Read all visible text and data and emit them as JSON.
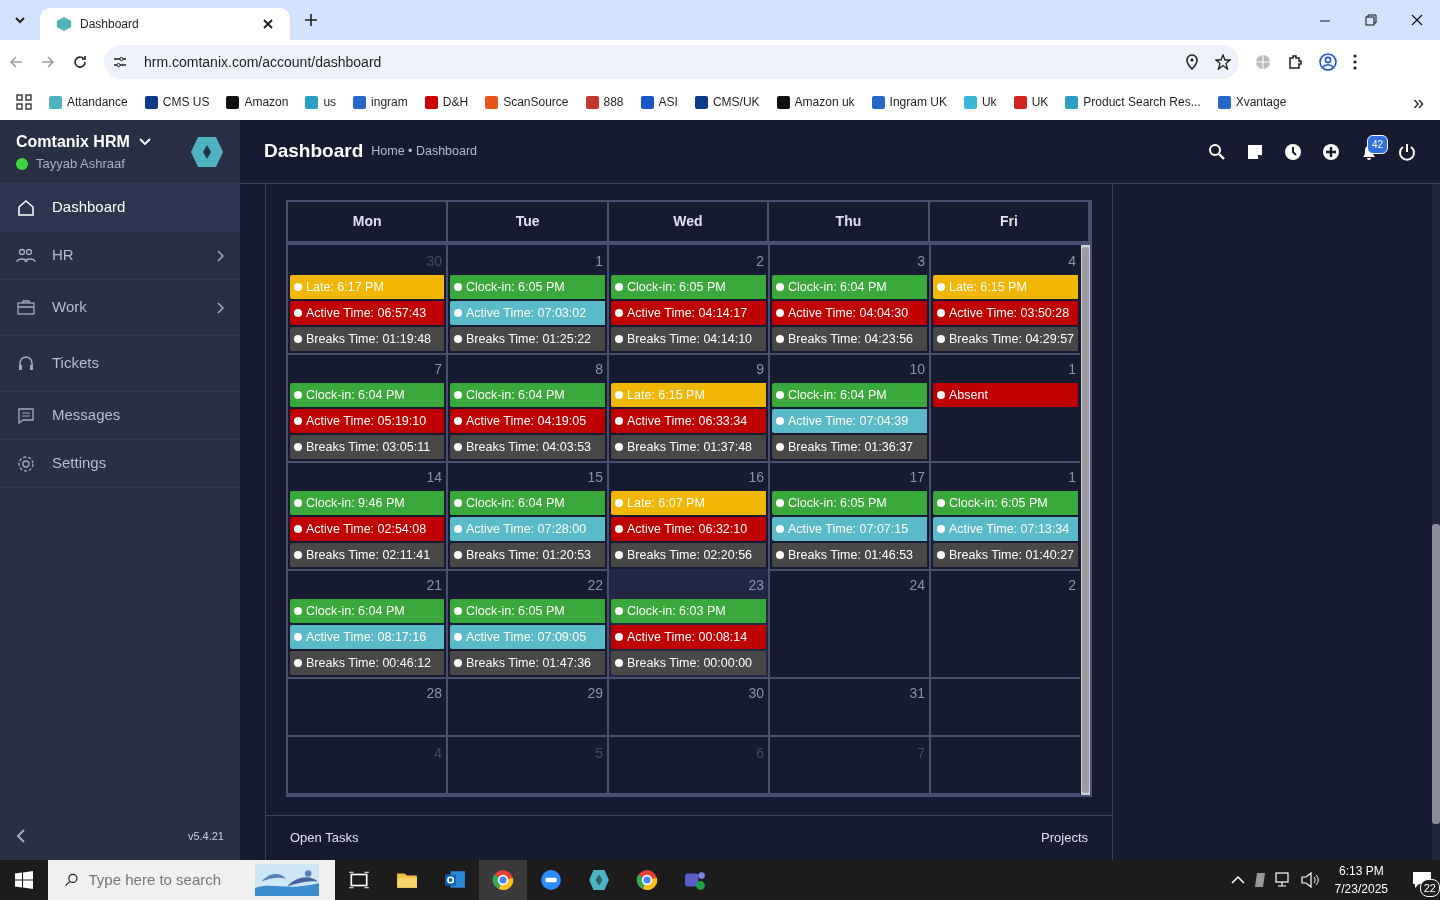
{
  "browser": {
    "tab": {
      "title": "Dashboard"
    },
    "url": "hrm.comtanix.com/account/dashboard",
    "bookmarks": [
      "Attandance",
      "CMS US",
      "Amazon",
      "us",
      "ingram",
      "D&H",
      "ScanSource",
      "888",
      "ASI",
      "CMS/UK",
      "Amazon uk",
      "Ingram UK",
      "Uk",
      "UK",
      "Product Search Res...",
      "Xvantage"
    ],
    "more": "»"
  },
  "sidebar": {
    "app_name": "Comtanix HRM",
    "user": "Tayyab Ashraaf",
    "online": true,
    "items": [
      {
        "label": "Dashboard",
        "selected": true,
        "has_children": false
      },
      {
        "label": "HR",
        "selected": false,
        "has_children": true
      },
      {
        "label": "Work",
        "selected": false,
        "has_children": true
      },
      {
        "label": "Tickets",
        "selected": false,
        "has_children": false
      },
      {
        "label": "Messages",
        "selected": false,
        "has_children": false
      },
      {
        "label": "Settings",
        "selected": false,
        "has_children": false
      }
    ],
    "version": "v5.4.21"
  },
  "header": {
    "title": "Dashboard",
    "breadcrumb": "Home • Dashboard",
    "notification_count": "42"
  },
  "calendar": {
    "days": [
      "Mon",
      "Tue",
      "Wed",
      "Thu",
      "Fri"
    ],
    "weeks": [
      [
        {
          "number": "30",
          "other_month": true,
          "today": false,
          "events": [
            {
              "text": "Late: 6:17 PM",
              "color": "#f2b705"
            },
            {
              "text": "Active Time: 06:57:43",
              "color": "#c00000"
            },
            {
              "text": "Breaks Time: 01:19:48",
              "color": "#484848"
            }
          ]
        },
        {
          "number": "1",
          "other_month": false,
          "today": false,
          "events": [
            {
              "text": "Clock-in: 6:05 PM",
              "color": "#3aa83a"
            },
            {
              "text": "Active Time: 07:03:02",
              "color": "#5bbac8"
            },
            {
              "text": "Breaks Time: 01:25:22",
              "color": "#484848"
            }
          ]
        },
        {
          "number": "2",
          "other_month": false,
          "today": false,
          "events": [
            {
              "text": "Clock-in: 6:05 PM",
              "color": "#3aa83a"
            },
            {
              "text": "Active Time: 04:14:17",
              "color": "#c00000"
            },
            {
              "text": "Breaks Time: 04:14:10",
              "color": "#484848"
            }
          ]
        },
        {
          "number": "3",
          "other_month": false,
          "today": false,
          "events": [
            {
              "text": "Clock-in: 6:04 PM",
              "color": "#3aa83a"
            },
            {
              "text": "Active Time: 04:04:30",
              "color": "#c00000"
            },
            {
              "text": "Breaks Time: 04:23:56",
              "color": "#484848"
            }
          ]
        },
        {
          "number": "4",
          "other_month": false,
          "today": false,
          "events": [
            {
              "text": "Late: 6:15 PM",
              "color": "#f2b705"
            },
            {
              "text": "Active Time: 03:50:28",
              "color": "#c00000"
            },
            {
              "text": "Breaks Time: 04:29:57",
              "color": "#484848"
            }
          ]
        }
      ],
      [
        {
          "number": "7",
          "other_month": false,
          "today": false,
          "events": [
            {
              "text": "Clock-in: 6:04 PM",
              "color": "#3aa83a"
            },
            {
              "text": "Active Time: 05:19:10",
              "color": "#c00000"
            },
            {
              "text": "Breaks Time: 03:05:11",
              "color": "#484848"
            }
          ]
        },
        {
          "number": "8",
          "other_month": false,
          "today": false,
          "events": [
            {
              "text": "Clock-in: 6:04 PM",
              "color": "#3aa83a"
            },
            {
              "text": "Active Time: 04:19:05",
              "color": "#c00000"
            },
            {
              "text": "Breaks Time: 04:03:53",
              "color": "#484848"
            }
          ]
        },
        {
          "number": "9",
          "other_month": false,
          "today": false,
          "events": [
            {
              "text": "Late: 6:15 PM",
              "color": "#f2b705"
            },
            {
              "text": "Active Time: 06:33:34",
              "color": "#c00000"
            },
            {
              "text": "Breaks Time: 01:37:48",
              "color": "#484848"
            }
          ]
        },
        {
          "number": "10",
          "other_month": false,
          "today": false,
          "events": [
            {
              "text": "Clock-in: 6:04 PM",
              "color": "#3aa83a"
            },
            {
              "text": "Active Time: 07:04:39",
              "color": "#5bbac8"
            },
            {
              "text": "Breaks Time: 01:36:37",
              "color": "#484848"
            }
          ]
        },
        {
          "number": "1",
          "other_month": false,
          "today": false,
          "events": [
            {
              "text": "Absent",
              "color": "#c00000"
            }
          ]
        }
      ],
      [
        {
          "number": "14",
          "other_month": false,
          "today": false,
          "events": [
            {
              "text": "Clock-in: 9:46 PM",
              "color": "#3aa83a"
            },
            {
              "text": "Active Time: 02:54:08",
              "color": "#c00000"
            },
            {
              "text": "Breaks Time: 02:11:41",
              "color": "#484848"
            }
          ]
        },
        {
          "number": "15",
          "other_month": false,
          "today": false,
          "events": [
            {
              "text": "Clock-in: 6:04 PM",
              "color": "#3aa83a"
            },
            {
              "text": "Active Time: 07:28:00",
              "color": "#5bbac8"
            },
            {
              "text": "Breaks Time: 01:20:53",
              "color": "#484848"
            }
          ]
        },
        {
          "number": "16",
          "other_month": false,
          "today": false,
          "events": [
            {
              "text": "Late: 6:07 PM",
              "color": "#f2b705"
            },
            {
              "text": "Active Time: 06:32:10",
              "color": "#c00000"
            },
            {
              "text": "Breaks Time: 02:20:56",
              "color": "#484848"
            }
          ]
        },
        {
          "number": "17",
          "other_month": false,
          "today": false,
          "events": [
            {
              "text": "Clock-in: 6:05 PM",
              "color": "#3aa83a"
            },
            {
              "text": "Active Time: 07:07:15",
              "color": "#5bbac8"
            },
            {
              "text": "Breaks Time: 01:46:53",
              "color": "#484848"
            }
          ]
        },
        {
          "number": "1",
          "other_month": false,
          "today": false,
          "events": [
            {
              "text": "Clock-in: 6:05 PM",
              "color": "#3aa83a"
            },
            {
              "text": "Active Time: 07:13:34",
              "color": "#5bbac8"
            },
            {
              "text": "Breaks Time: 01:40:27",
              "color": "#484848"
            }
          ]
        }
      ],
      [
        {
          "number": "21",
          "other_month": false,
          "today": false,
          "events": [
            {
              "text": "Clock-in: 6:04 PM",
              "color": "#3aa83a"
            },
            {
              "text": "Active Time: 08:17:16",
              "color": "#5bbac8"
            },
            {
              "text": "Breaks Time: 00:46:12",
              "color": "#484848"
            }
          ]
        },
        {
          "number": "22",
          "other_month": false,
          "today": false,
          "events": [
            {
              "text": "Clock-in: 6:05 PM",
              "color": "#3aa83a"
            },
            {
              "text": "Active Time: 07:09:05",
              "color": "#5bbac8"
            },
            {
              "text": "Breaks Time: 01:47:36",
              "color": "#484848"
            }
          ]
        },
        {
          "number": "23",
          "other_month": false,
          "today": true,
          "events": [
            {
              "text": "Clock-in: 6:03 PM",
              "color": "#3aa83a"
            },
            {
              "text": "Active Time: 00:08:14",
              "color": "#c00000"
            },
            {
              "text": "Breaks Time: 00:00:00",
              "color": "#484848"
            }
          ]
        },
        {
          "number": "24",
          "other_month": false,
          "today": false
        },
        {
          "number": "2",
          "other_month": false,
          "today": false
        }
      ],
      [
        {
          "number": "28",
          "other_month": false,
          "today": false
        },
        {
          "number": "29",
          "other_month": false,
          "today": false
        },
        {
          "number": "30",
          "other_month": false,
          "today": false
        },
        {
          "number": "31",
          "other_month": false,
          "today": false
        },
        {
          "today": false
        }
      ],
      [
        {
          "number": "4",
          "other_month": true,
          "today": false
        },
        {
          "number": "5",
          "other_month": true,
          "today": false
        },
        {
          "number": "6",
          "other_month": true,
          "today": false
        },
        {
          "number": "7",
          "other_month": true,
          "today": false
        },
        {
          "today": false
        }
      ]
    ]
  },
  "footer_tabs": [
    "Open Tasks",
    "Projects"
  ],
  "taskbar": {
    "search_placeholder": "Type here to search",
    "time": "6:13 PM",
    "date": "7/23/2025",
    "notifications": "22"
  }
}
